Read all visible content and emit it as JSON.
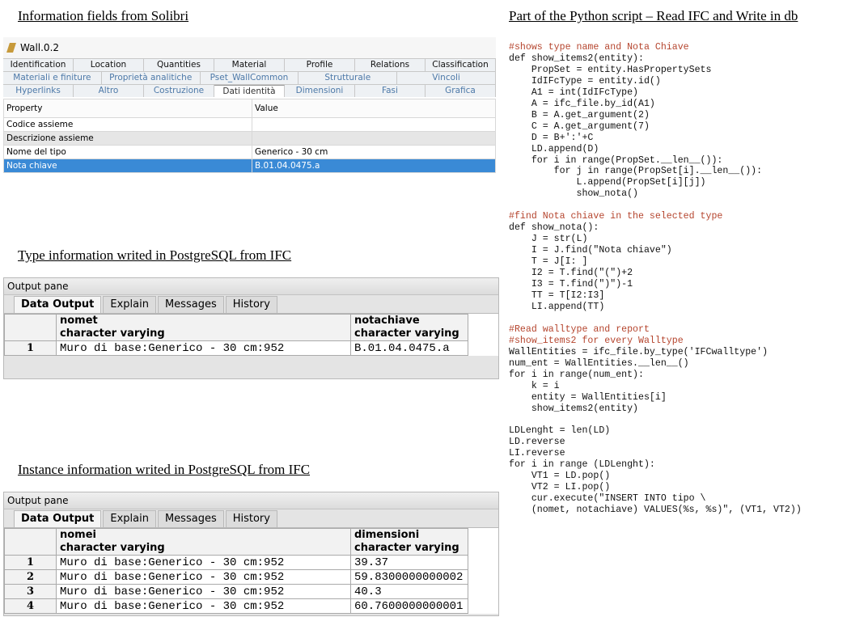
{
  "headings": {
    "solibri": "Information fields from Solibri",
    "python": "Part of the Python script – Read IFC and Write in db",
    "type_info": "Type information writed in PostgreSQL from IFC",
    "instance_info": "Instance information writed in PostgreSQL from IFC"
  },
  "solibri": {
    "object_title": "Wall.0.2",
    "tab_rows": [
      [
        "Identification",
        "Location",
        "Quantities",
        "Material",
        "Profile",
        "Relations",
        "Classification"
      ],
      [
        "Materiali e finiture",
        "Proprietà analitiche",
        "Pset_WallCommon",
        "Strutturale",
        "Vincoli"
      ],
      [
        "Hyperlinks",
        "Altro",
        "Costruzione",
        "Dati identità",
        "Dimensioni",
        "Fasi",
        "Grafica"
      ]
    ],
    "active_tab": "Dati identità",
    "columns": [
      "Property",
      "Value"
    ],
    "rows": [
      {
        "property": "Codice assieme",
        "value": ""
      },
      {
        "property": "Descrizione assieme",
        "value": ""
      },
      {
        "property": "Nome del tipo",
        "value": "Generico - 30 cm"
      },
      {
        "property": "Nota chiave",
        "value": "B.01.04.0475.a"
      }
    ],
    "selected_row": "Nota chiave"
  },
  "type_pane": {
    "title": "Output pane",
    "tabs": [
      "Data Output",
      "Explain",
      "Messages",
      "History"
    ],
    "columns": [
      {
        "name": "nomet",
        "type": "character varying"
      },
      {
        "name": "notachiave",
        "type": "character varying"
      }
    ],
    "rows": [
      {
        "n": "1",
        "c1": "Muro di base:Generico - 30 cm:952",
        "c2": "B.01.04.0475.a"
      }
    ]
  },
  "instance_pane": {
    "title": "Output pane",
    "tabs": [
      "Data Output",
      "Explain",
      "Messages",
      "History"
    ],
    "columns": [
      {
        "name": "nomei",
        "type": "character varying"
      },
      {
        "name": "dimensioni",
        "type": "character varying"
      }
    ],
    "rows": [
      {
        "n": "1",
        "c1": "Muro di base:Generico - 30 cm:952",
        "c2": "39.37"
      },
      {
        "n": "2",
        "c1": "Muro di base:Generico - 30 cm:952",
        "c2": "59.8300000000002"
      },
      {
        "n": "3",
        "c1": "Muro di base:Generico - 30 cm:952",
        "c2": "40.3"
      },
      {
        "n": "4",
        "c1": "Muro di base:Generico - 30 cm:952",
        "c2": "60.7600000000001"
      }
    ]
  },
  "code_lines": [
    "#shows type name and Nota Chiave",
    "def show_items2(entity):",
    "    PropSet = entity.HasPropertySets",
    "    IdIFcType = entity.id()",
    "    A1 = int(IdIFcType)",
    "    A = ifc_file.by_id(A1)",
    "    B = A.get_argument(2)",
    "    C = A.get_argument(7)",
    "    D = B+':'+C",
    "    LD.append(D)",
    "    for i in range(PropSet.__len__()):",
    "        for j in range(PropSet[i].__len__()):",
    "            L.append(PropSet[i][j])",
    "            show_nota()",
    "",
    "#find Nota chiave in the selected type",
    "def show_nota():",
    "    J = str(L)",
    "    I = J.find(\"Nota chiave\")",
    "    T = J[I: ]",
    "    I2 = T.find(\"(\")+2",
    "    I3 = T.find(\")\")-1",
    "    TT = T[I2:I3]",
    "    LI.append(TT)",
    "",
    "#Read walltype and report",
    "#show_items2 for every Walltype",
    "WallEntities = ifc_file.by_type('IFCwalltype')",
    "num_ent = WallEntities.__len__()",
    "for i in range(num_ent):",
    "    k = i",
    "    entity = WallEntities[i]",
    "    show_items2(entity)",
    "",
    "LDLenght = len(LD)",
    "LD.reverse",
    "LI.reverse",
    "for i in range (LDLenght):",
    "    VT1 = LD.pop()",
    "    VT2 = LI.pop()",
    "    cur.execute(\"INSERT INTO tipo \\",
    "    (nomet, notachiave) VALUES(%s, %s)\", (VT1, VT2))"
  ]
}
